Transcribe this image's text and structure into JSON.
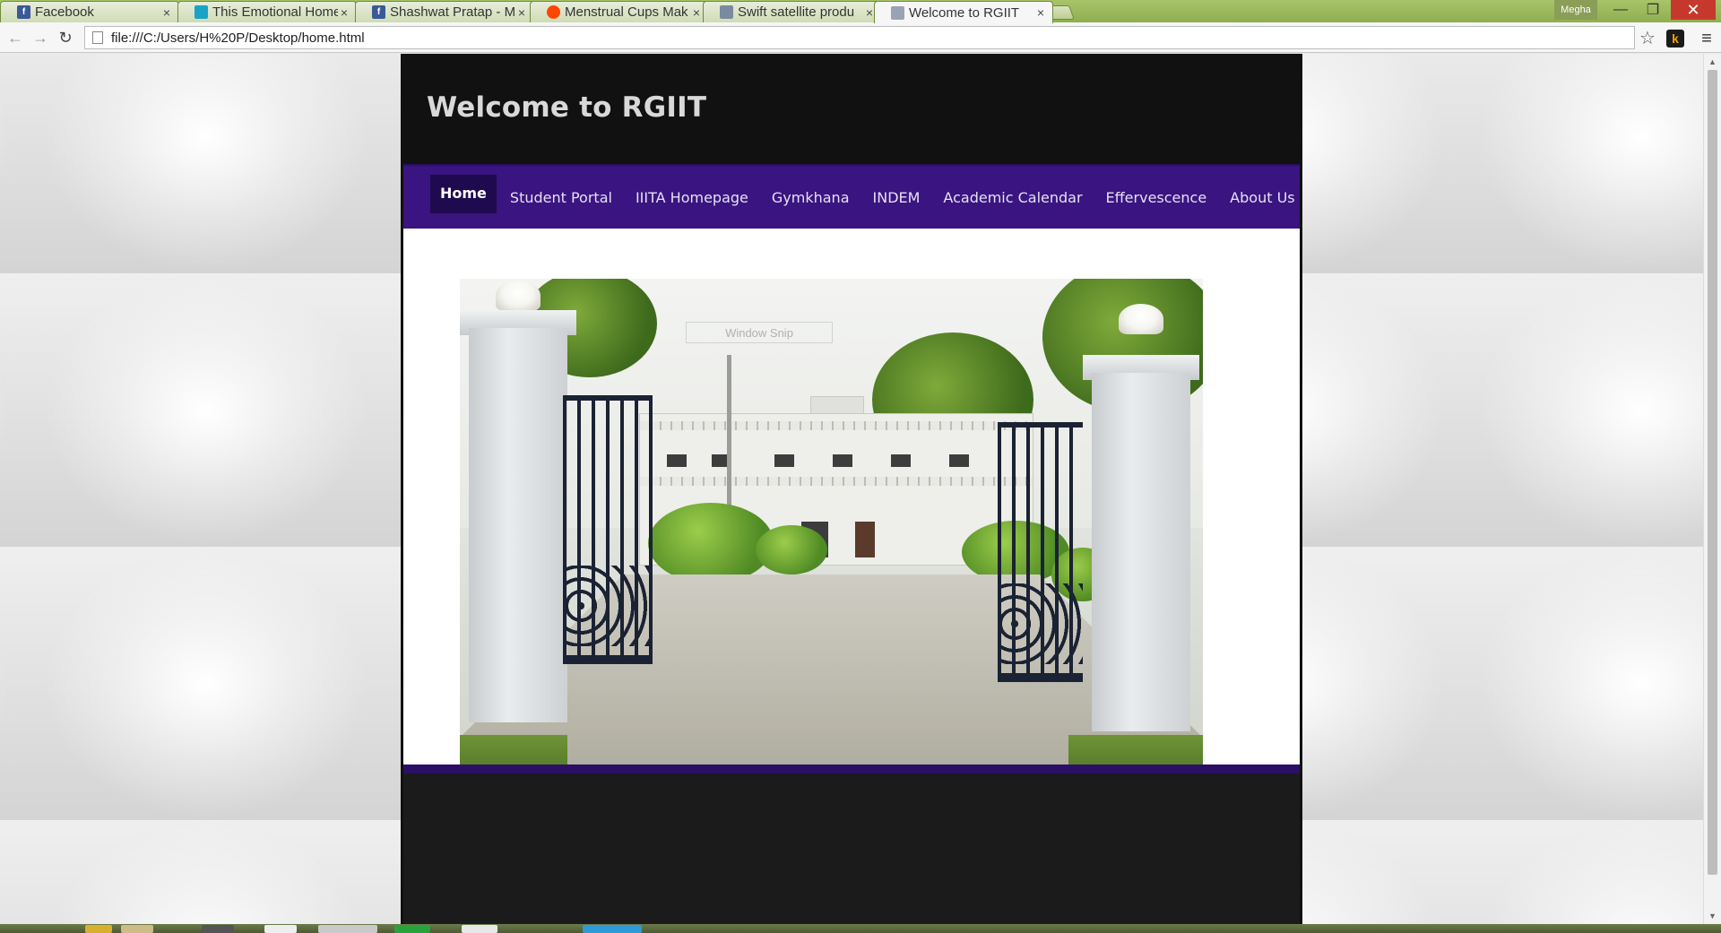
{
  "browser": {
    "tabs": [
      {
        "title": "Facebook",
        "icon": "facebook-icon",
        "icon_color": "#3b5998",
        "glyph": "f"
      },
      {
        "title": "This Emotional Home",
        "icon": "blog-icon",
        "icon_color": "#1aa3c7",
        "glyph": ""
      },
      {
        "title": "Shashwat Pratap - M",
        "icon": "facebook-icon",
        "icon_color": "#3b5998",
        "glyph": "f"
      },
      {
        "title": "Menstrual Cups Mak",
        "icon": "reddit-icon",
        "icon_color": "#ff4500",
        "glyph": ""
      },
      {
        "title": "Swift satellite produ",
        "icon": "satellite-icon",
        "icon_color": "#7a8aa0",
        "glyph": ""
      },
      {
        "title": "Welcome to RGIIT",
        "icon": "page-icon",
        "icon_color": "#9aa3b3",
        "glyph": "",
        "active": true
      }
    ],
    "profile_name": "Megha",
    "url": "file:///C:/Users/H%20P/Desktop/home.html",
    "window_controls": {
      "minimize": "—",
      "maximize": "❐",
      "close": "✕"
    },
    "extension_label": "k"
  },
  "site": {
    "title": "Welcome to RGIIT",
    "nav": [
      {
        "label": "Home",
        "active": true
      },
      {
        "label": "Student Portal"
      },
      {
        "label": "IIITA Homepage"
      },
      {
        "label": "Gymkhana"
      },
      {
        "label": "INDEM"
      },
      {
        "label": "Academic Calendar"
      },
      {
        "label": "Effervescence"
      },
      {
        "label": "About Us"
      }
    ],
    "image_overlay_text": "Window Snip",
    "colors": {
      "header_bg": "#111111",
      "nav_bg": "#3a1480",
      "nav_active_bg": "#1f0a4f",
      "title_color": "#d9d9d9"
    }
  }
}
